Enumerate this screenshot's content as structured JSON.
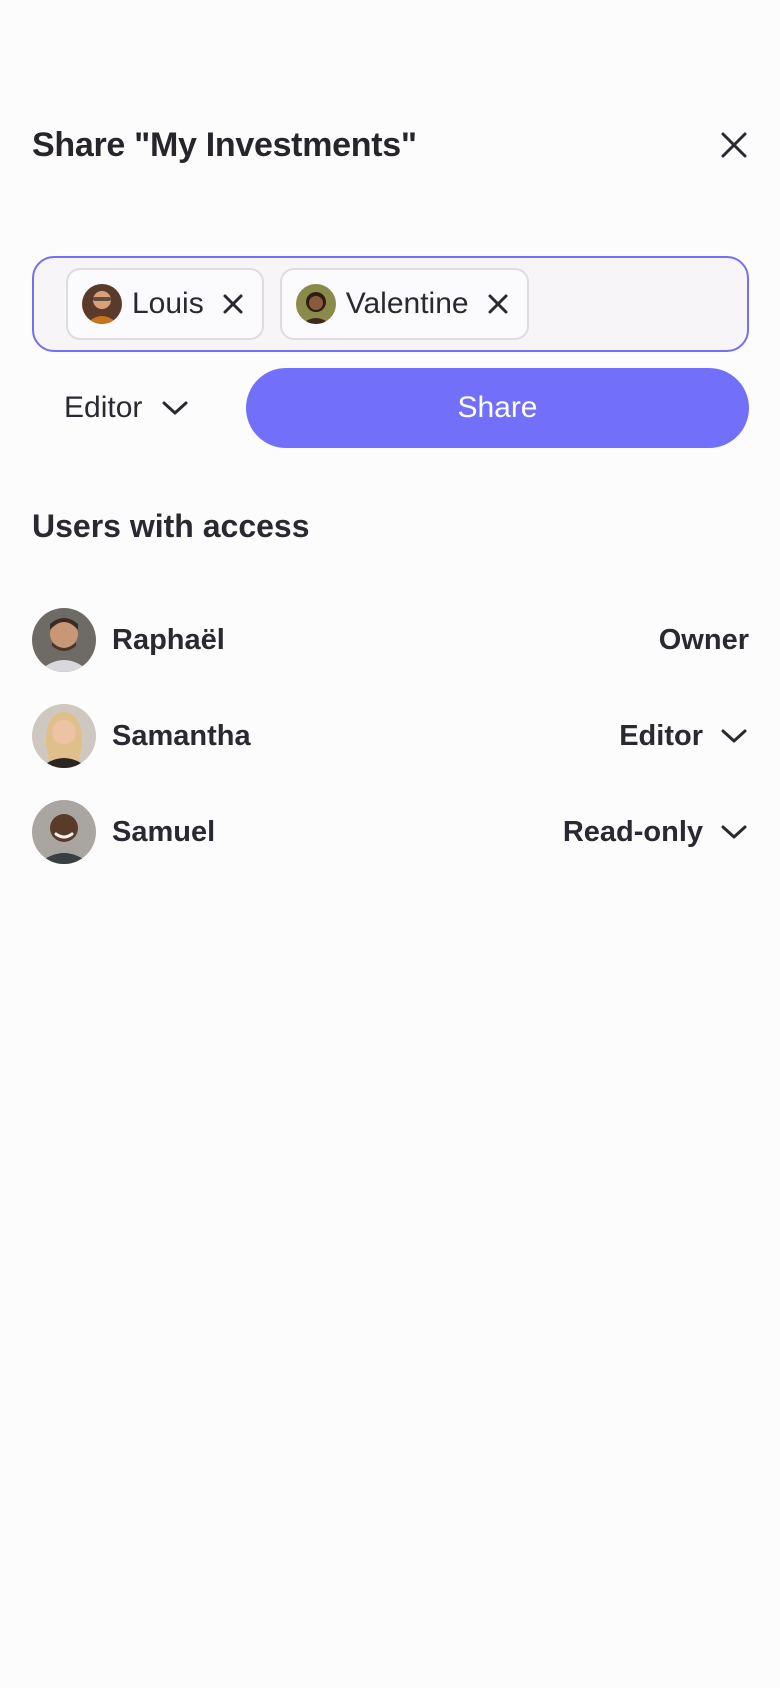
{
  "header": {
    "title": "Share \"My Investments\"",
    "close_icon": "close-icon"
  },
  "recipients": [
    {
      "name": "Louis",
      "avatar": "avatar-photo",
      "remove_icon": "close-icon"
    },
    {
      "name": "Valentine",
      "avatar": "avatar-photo",
      "remove_icon": "close-icon"
    }
  ],
  "controls": {
    "role_selected": "Editor",
    "role_icon": "chevron-down-icon",
    "share_label": "Share"
  },
  "access": {
    "title": "Users with access",
    "users": [
      {
        "name": "Raphaël",
        "role": "Owner",
        "has_dropdown": false
      },
      {
        "name": "Samantha",
        "role": "Editor",
        "has_dropdown": true
      },
      {
        "name": "Samuel",
        "role": "Read-only",
        "has_dropdown": true
      }
    ]
  },
  "colors": {
    "accent": "#7270fb",
    "input_border": "#7370f5",
    "text": "#2a2830",
    "background": "#fdfcfd"
  }
}
